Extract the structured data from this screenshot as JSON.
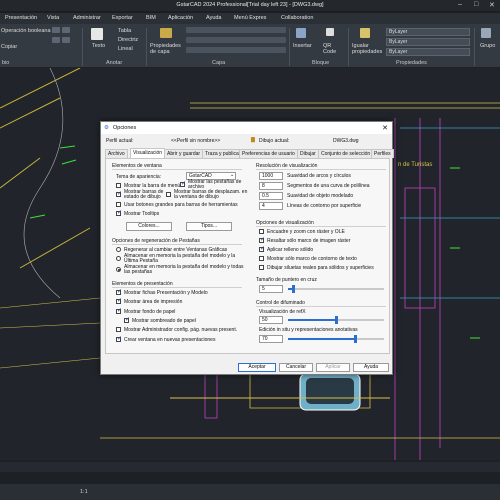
{
  "window": {
    "title": "GstarCAD 2024 Professional[Trial day left 23] - [DWG3.dwg]"
  },
  "menubar": {
    "items": [
      "Presentación",
      "Vista",
      "Administrar",
      "Exportar",
      "BIM",
      "Aplicación",
      "Ayuda",
      "Menú Expres",
      "Collaboration"
    ]
  },
  "ribbon": {
    "left_items": [
      "Operación booleana",
      "Copiar"
    ],
    "texto": "Texto",
    "tabla": "Tabla",
    "directriz": "Directriz",
    "lineal": "Lineal",
    "prop_capa": "Propiedades de capa",
    "insertar": "Insertar",
    "qr_code": "QR Code",
    "igualar": "Igualar propiedades",
    "bylayer": "ByLayer",
    "grupo": "Grupo",
    "groups": [
      "bio",
      "Anotar",
      "Capa",
      "Bloque",
      "Propiedades"
    ]
  },
  "drawing": {
    "label": "n de Turistas"
  },
  "dialog": {
    "title": "Opciones",
    "perfil_label": "Perfil actual:",
    "perfil_value": "<<Perfil sin nombre>>",
    "dibujo_label": "Dibujo actual:",
    "dibujo_value": "DWG3.dwg",
    "tabs": [
      "Archivo",
      "Visualización",
      "Abrir y guardar",
      "Traza y publica",
      "Preferencias de usuario",
      "Dibujar",
      "Conjunto de selección",
      "Perfiles"
    ],
    "elementos_ventana": {
      "header": "Elementos de ventana",
      "tema_label": "Tema de apariencia:",
      "tema_value": "GstarCAD",
      "c1": "Mostrar la barra de menú",
      "c2": "Mostrar las pestañas de archivo",
      "c3": "Mostrar barras de estado de dibujo",
      "c4": "Mostrar barras de desplazam. en la ventana de dibujo",
      "c5": "Usar botones grandes para barras de herramientas",
      "c6": "Mostrar Tooltips",
      "colores": "Colores...",
      "tipos": "Tipos..."
    },
    "regeneracion": {
      "header": "Opciones de regeneración de Pestañas",
      "r1": "Regenerar al cambiar entre Ventanas Gráficas",
      "r2": "Almacenar en memoria la pestaña del modelo y la Última Pestaña",
      "r3": "Almacenar en memoria la pestaña del modelo y todas las pestañas"
    },
    "presentacion": {
      "header": "Elementos de presentación",
      "p1": "Mostrar fichas Presentación y Modelo",
      "p2": "Mostrar área de impresión",
      "p3": "Mostrar fondo de papel",
      "p4": "Mostrar sombreado de papel",
      "p5": "Mostrar Administrador config. pág. nuevas present.",
      "p6": "Crear ventana en nuevas presentaciones"
    },
    "resolucion": {
      "header": "Resolución de visualización",
      "v1": "1000",
      "l1": "Suavidad de arcos y círculos",
      "v2": "8",
      "l2": "Segmentos de una curva de polilínea",
      "v3": "0.5",
      "l3": "Suavidad de objeto modelado",
      "v4": "4",
      "l4": "Líneas de contorno por superficie"
    },
    "opciones_vis": {
      "header": "Opciones de visualización",
      "o1": "Encuadre y zoom con ráster y OLE",
      "o2": "Resaltar sólo marco de imagen ráster",
      "o3": "Aplicar relleno sólido",
      "o4": "Mostrar sólo marco de contorno de texto",
      "o5": "Dibujar siluetas reales para sólidos y superficies"
    },
    "puntero": {
      "header": "Tamaño de puntero en cruz",
      "value": "5",
      "level": 0.05
    },
    "difuminado": {
      "header": "Control de difuminado",
      "xref_label": "Visualización de refX",
      "xref_value": "50",
      "xref_level": 0.5,
      "edicion_label": "Edición in situ y representaciones anotativas",
      "edicion_value": "70",
      "edicion_level": 0.7
    },
    "buttons": {
      "aceptar": "Aceptar",
      "cancelar": "Cancelar",
      "aplicar": "Aplicar",
      "ayuda": "Ayuda"
    }
  },
  "statusbar": {
    "zoom": "1:1",
    "coords": ""
  }
}
